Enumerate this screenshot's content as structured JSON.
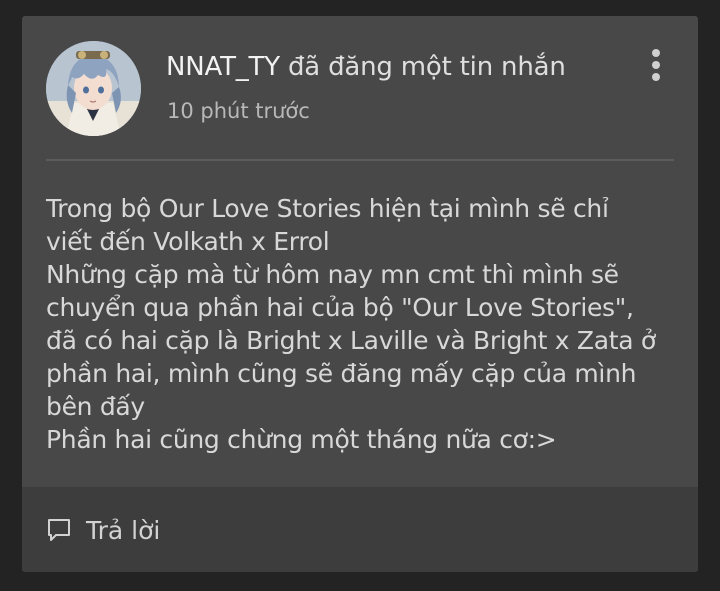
{
  "post": {
    "author": "NNAT_TY",
    "action": "đã đăng một tin nhắn",
    "timestamp": "10 phút trước",
    "body_lines": [
      "Trong bộ Our Love Stories hiện tại mình sẽ chỉ",
      "viết đến Volkath x Errol",
      "Những cặp mà từ hôm nay mn cmt thì mình sẽ",
      "chuyển qua phần hai của bộ \"Our Love Stories\",",
      "đã có hai cặp là Bright x Laville và Bright x Zata ở",
      "phần hai, mình cũng sẽ đăng mấy cặp của mình",
      "bên đấy",
      "Phần hai cũng chừng một tháng nữa cơ:>"
    ]
  },
  "footer": {
    "reply_label": "Trả lời",
    "reply_icon": "speech-bubble-icon"
  },
  "menu": {
    "icon": "more-vertical-icon"
  },
  "colors": {
    "background": "#232323",
    "card": "#484848",
    "footer": "#3d3d3d",
    "text": "#d8d8d8"
  }
}
